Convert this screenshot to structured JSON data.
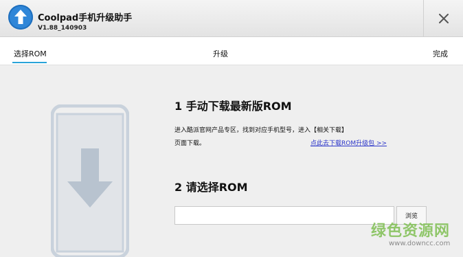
{
  "window": {
    "title": "Coolpad手机升级助手",
    "version": "V1.88_140903",
    "close_icon": "close-icon"
  },
  "steps": [
    {
      "label": "选择ROM",
      "active": true
    },
    {
      "label": "升级",
      "active": false
    },
    {
      "label": "完成",
      "active": false
    }
  ],
  "section1": {
    "title": "1 手动下载最新版ROM",
    "desc_line1": "进入酷派官网产品专区，找到对应手机型号，进入【相关下载】",
    "desc_line2": "页面下载。",
    "link": "点此去下载ROM升级包 >>"
  },
  "section2": {
    "title": "2 请选择ROM",
    "input_value": "",
    "browse_label": "浏览"
  },
  "watermark": {
    "text": "绿色资源网",
    "url": "www.downcc.com"
  },
  "colors": {
    "accent": "#29a3d8",
    "logo_blue": "#2f86d8",
    "link": "#2b35c9",
    "illustration": "#c9d2dc"
  }
}
